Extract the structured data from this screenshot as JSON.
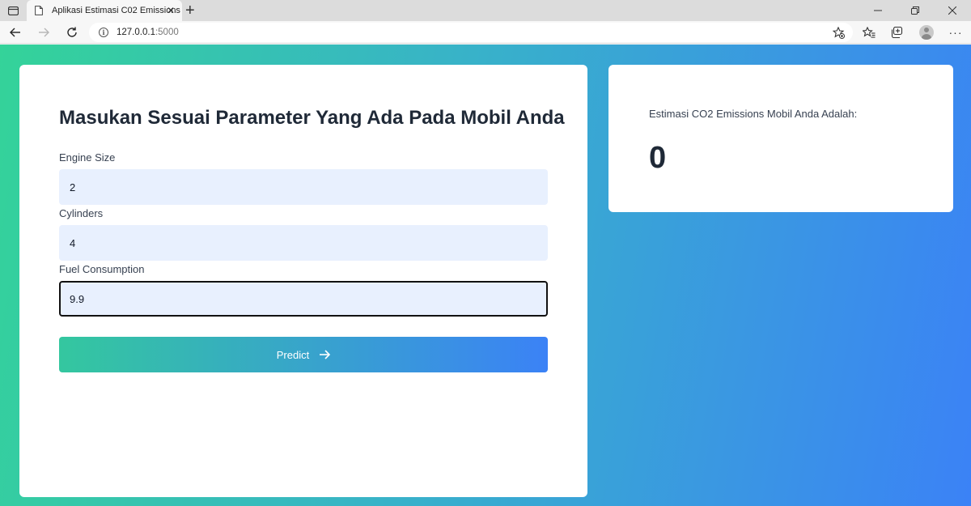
{
  "browser": {
    "tab_title": "Aplikasi Estimasi C02 Emissions",
    "tab_close": "✕",
    "new_tab": "+",
    "url_host": "127.0.0.1",
    "url_port": ":5000"
  },
  "form": {
    "title": "Masukan Sesuai Parameter Yang Ada Pada Mobil Anda",
    "fields": [
      {
        "label": "Engine Size",
        "value": "2"
      },
      {
        "label": "Cylinders",
        "value": "4"
      },
      {
        "label": "Fuel Consumption",
        "value": "9.9"
      }
    ],
    "button_label": "Predict"
  },
  "result": {
    "label": "Estimasi CO2 Emissions Mobil Anda Adalah:",
    "value": "0"
  },
  "icons": [
    "window-icon",
    "page-favicon-icon",
    "back-arrow-icon",
    "forward-arrow-icon",
    "refresh-icon",
    "info-icon",
    "favorite-star-add-icon",
    "favorites-icon",
    "collections-icon",
    "profile-avatar-icon",
    "more-options-icon",
    "minimize-icon",
    "restore-icon",
    "close-window-icon",
    "arrow-right-icon"
  ],
  "colors": {
    "gradient_start": "#34d399",
    "gradient_end": "#3b82f6",
    "input_bg": "#e8f0fe",
    "title_text": "#1f2937"
  }
}
